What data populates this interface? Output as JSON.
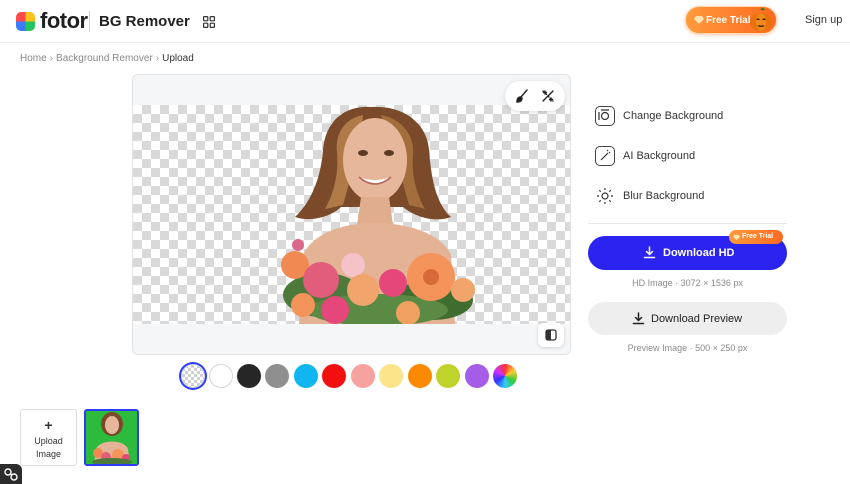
{
  "header": {
    "logo_text": "fotor",
    "product_name": "BG Remover",
    "free_trial_label": "Free Trial",
    "signup_label": "Sign up"
  },
  "breadcrumb": {
    "items": [
      "Home",
      "Background Remover",
      "Upload"
    ]
  },
  "canvas": {
    "tools": [
      "brush-icon",
      "magic-eraser-icon"
    ],
    "compare_icon": "compare-icon"
  },
  "swatches": [
    {
      "name": "transparent",
      "color": "transparent",
      "selected": true
    },
    {
      "name": "white",
      "color": "#ffffff"
    },
    {
      "name": "black",
      "color": "#262626"
    },
    {
      "name": "gray",
      "color": "#8f8f8f"
    },
    {
      "name": "cyan",
      "color": "#10b6f0"
    },
    {
      "name": "red",
      "color": "#f20f0f"
    },
    {
      "name": "pink",
      "color": "#f7a1a1"
    },
    {
      "name": "light-yellow",
      "color": "#fbe489"
    },
    {
      "name": "orange",
      "color": "#fb8a00"
    },
    {
      "name": "lime",
      "color": "#bfd32b"
    },
    {
      "name": "purple",
      "color": "#a55ce6"
    },
    {
      "name": "rainbow",
      "color": "conic"
    }
  ],
  "options": [
    {
      "label": "Change Background",
      "icon": "change-background-icon"
    },
    {
      "label": "AI Background",
      "icon": "ai-background-icon"
    },
    {
      "label": "Blur Background",
      "icon": "blur-background-icon"
    }
  ],
  "download_hd": {
    "label": "Download HD",
    "badge": "Free Trial",
    "info": "HD Image · 3072 × 1536 px"
  },
  "download_preview": {
    "label": "Download Preview",
    "info": "Preview Image · 500 × 250 px"
  },
  "upload": {
    "plus": "+",
    "label_line1": "Upload",
    "label_line2": "Image"
  },
  "colors": {
    "primary": "#2b23f0",
    "accent_orange": "#ff7a2a",
    "thumb_bg": "#2dbb3d"
  }
}
